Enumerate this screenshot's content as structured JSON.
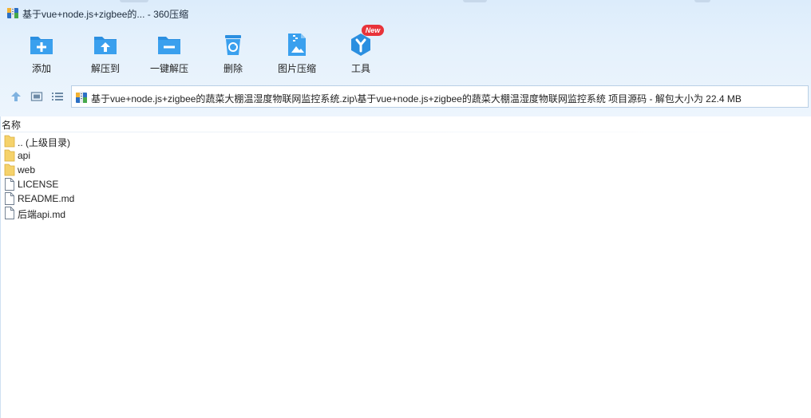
{
  "window": {
    "title": "基于vue+node.js+zigbee的... - 360压缩"
  },
  "toolbar": {
    "items": [
      {
        "label": "添加",
        "icon": "add-folder-icon"
      },
      {
        "label": "解压到",
        "icon": "extract-to-icon"
      },
      {
        "label": "一键解压",
        "icon": "one-click-extract-icon"
      },
      {
        "label": "删除",
        "icon": "recycle-bin-icon"
      },
      {
        "label": "图片压缩",
        "icon": "image-compress-icon"
      },
      {
        "label": "工具",
        "icon": "tools-icon",
        "badge": "New"
      }
    ]
  },
  "nav": {
    "up_icon": "up-arrow-icon",
    "thumbnail_icon": "thumbnail-view-icon",
    "list_icon": "list-view-icon",
    "path": "基于vue+node.js+zigbee的蔬菜大棚温湿度物联网监控系统.zip\\基于vue+node.js+zigbee的蔬菜大棚温湿度物联网监控系统 项目源码 - 解包大小为 22.4 MB"
  },
  "list": {
    "column_name": "名称",
    "rows": [
      {
        "name": ".. (上级目录)",
        "type": "folder"
      },
      {
        "name": "api",
        "type": "folder"
      },
      {
        "name": "web",
        "type": "folder"
      },
      {
        "name": "LICENSE",
        "type": "file"
      },
      {
        "name": "README.md",
        "type": "file"
      },
      {
        "name": "后端api.md",
        "type": "file"
      }
    ]
  },
  "colors": {
    "accent": "#2b8fe0",
    "badge": "#e8333a",
    "toolbar_bg": "#e5f1fc",
    "folder": "#f5d26b"
  }
}
